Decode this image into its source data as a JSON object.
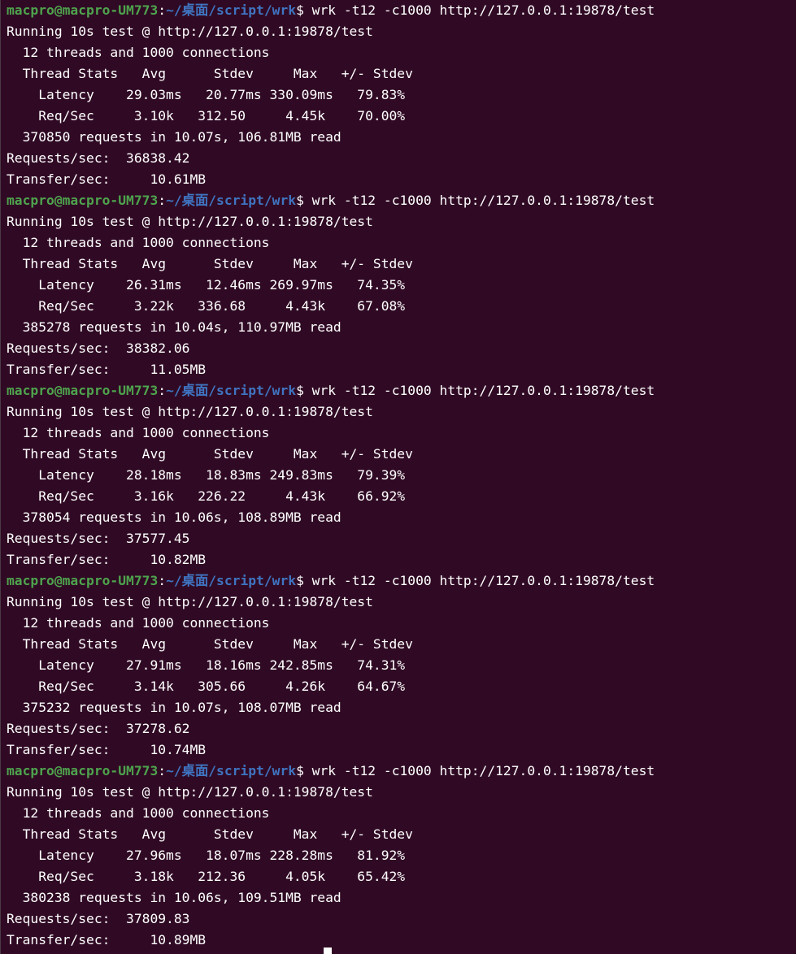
{
  "colors": {
    "background": "#300a24",
    "prompt_user": "#4ea34d",
    "prompt_path": "#3f74c1",
    "text": "#ffffff"
  },
  "runs": [
    {
      "prompt": {
        "user_host": "macpro@macpro-UM773",
        "colon": ":",
        "path": "~/桌面/script/wrk",
        "dollar": "$",
        "command": " wrk -t12 -c1000 http://127.0.0.1:19878/test"
      },
      "output": [
        "Running 10s test @ http://127.0.0.1:19878/test",
        "  12 threads and 1000 connections",
        "  Thread Stats   Avg      Stdev     Max   +/- Stdev",
        "    Latency    29.03ms   20.77ms 330.09ms   79.83%",
        "    Req/Sec     3.10k   312.50     4.45k    70.00%",
        "  370850 requests in 10.07s, 106.81MB read",
        "Requests/sec:  36838.42",
        "Transfer/sec:     10.61MB"
      ]
    },
    {
      "prompt": {
        "user_host": "macpro@macpro-UM773",
        "colon": ":",
        "path": "~/桌面/script/wrk",
        "dollar": "$",
        "command": " wrk -t12 -c1000 http://127.0.0.1:19878/test"
      },
      "output": [
        "Running 10s test @ http://127.0.0.1:19878/test",
        "  12 threads and 1000 connections",
        "  Thread Stats   Avg      Stdev     Max   +/- Stdev",
        "    Latency    26.31ms   12.46ms 269.97ms   74.35%",
        "    Req/Sec     3.22k   336.68     4.43k    67.08%",
        "  385278 requests in 10.04s, 110.97MB read",
        "Requests/sec:  38382.06",
        "Transfer/sec:     11.05MB"
      ]
    },
    {
      "prompt": {
        "user_host": "macpro@macpro-UM773",
        "colon": ":",
        "path": "~/桌面/script/wrk",
        "dollar": "$",
        "command": " wrk -t12 -c1000 http://127.0.0.1:19878/test"
      },
      "output": [
        "Running 10s test @ http://127.0.0.1:19878/test",
        "  12 threads and 1000 connections",
        "  Thread Stats   Avg      Stdev     Max   +/- Stdev",
        "    Latency    28.18ms   18.83ms 249.83ms   79.39%",
        "    Req/Sec     3.16k   226.22     4.43k    66.92%",
        "  378054 requests in 10.06s, 108.89MB read",
        "Requests/sec:  37577.45",
        "Transfer/sec:     10.82MB"
      ]
    },
    {
      "prompt": {
        "user_host": "macpro@macpro-UM773",
        "colon": ":",
        "path": "~/桌面/script/wrk",
        "dollar": "$",
        "command": " wrk -t12 -c1000 http://127.0.0.1:19878/test"
      },
      "output": [
        "Running 10s test @ http://127.0.0.1:19878/test",
        "  12 threads and 1000 connections",
        "  Thread Stats   Avg      Stdev     Max   +/- Stdev",
        "    Latency    27.91ms   18.16ms 242.85ms   74.31%",
        "    Req/Sec     3.14k   305.66     4.26k    64.67%",
        "  375232 requests in 10.07s, 108.07MB read",
        "Requests/sec:  37278.62",
        "Transfer/sec:     10.74MB"
      ]
    },
    {
      "prompt": {
        "user_host": "macpro@macpro-UM773",
        "colon": ":",
        "path": "~/桌面/script/wrk",
        "dollar": "$",
        "command": " wrk -t12 -c1000 http://127.0.0.1:19878/test"
      },
      "output": [
        "Running 10s test @ http://127.0.0.1:19878/test",
        "  12 threads and 1000 connections",
        "  Thread Stats   Avg      Stdev     Max   +/- Stdev",
        "    Latency    27.96ms   18.07ms 228.28ms   81.92%",
        "    Req/Sec     3.18k   212.36     4.05k    65.42%",
        "  380238 requests in 10.06s, 109.51MB read",
        "Requests/sec:  37809.83",
        "Transfer/sec:     10.89MB"
      ]
    }
  ]
}
